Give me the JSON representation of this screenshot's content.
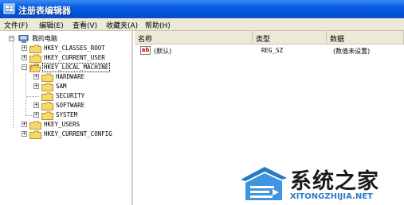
{
  "window": {
    "title": "注册表编辑器"
  },
  "menu": [
    "文件(F)",
    "编辑(E)",
    "查看(V)",
    "收藏夹(A)",
    "帮助(H)"
  ],
  "tree": {
    "root": "我的电脑",
    "nodes": [
      {
        "label": "HKEY_CLASSES_ROOT"
      },
      {
        "label": "HKEY_CURRENT_USER"
      },
      {
        "label": "HKEY_LOCAL_MACHINE",
        "selected": true
      },
      {
        "label": "HARDWARE"
      },
      {
        "label": "SAM"
      },
      {
        "label": "SECURITY"
      },
      {
        "label": "SOFTWARE"
      },
      {
        "label": "SYSTEM"
      },
      {
        "label": "HKEY_USERS"
      },
      {
        "label": "HKEY_CURRENT_CONFIG"
      }
    ]
  },
  "list": {
    "columns": [
      "名称",
      "类型",
      "数据"
    ],
    "rows": [
      {
        "name": "(默认)",
        "type": "REG_SZ",
        "data": "(数值未设置)",
        "icon": "ab-string-icon"
      }
    ]
  },
  "watermark": {
    "cn": "系统之家",
    "en": "XITONGZHIJIA.NET"
  },
  "colors": {
    "titlebar": "#0053d8",
    "accent": "#2a79c4"
  }
}
